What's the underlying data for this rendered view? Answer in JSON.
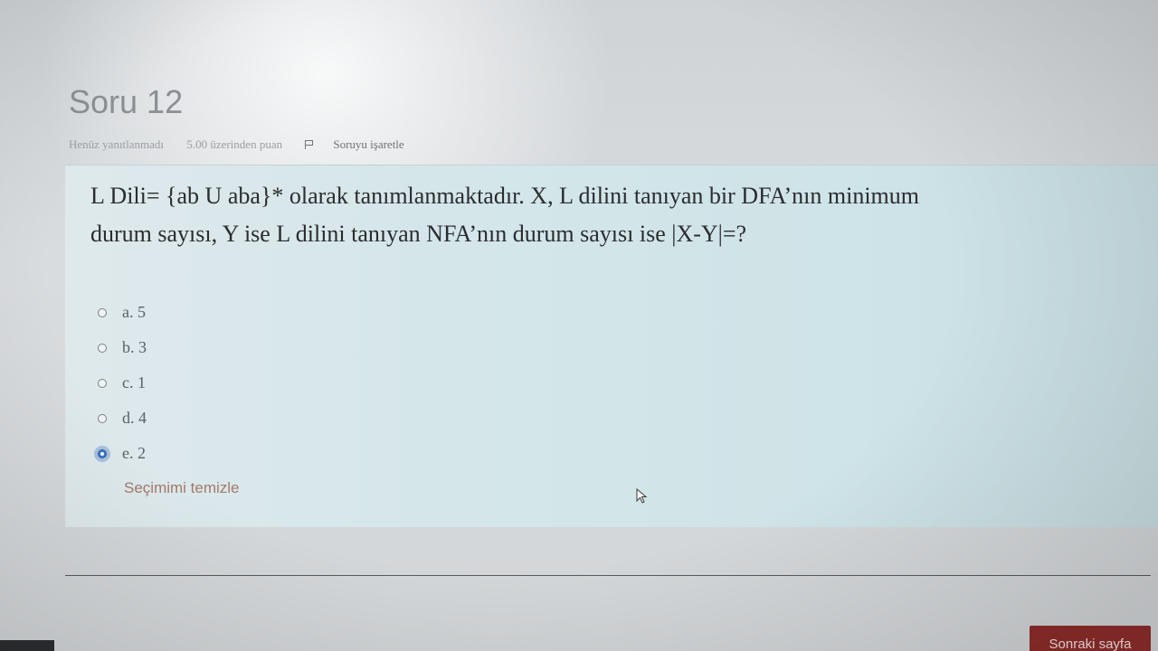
{
  "question": {
    "title": "Soru 12",
    "status": "Henüz yanıtlanmadı",
    "points": "5.00 üzerinden puan",
    "flag_label": "Soruyu işaretle",
    "text_line1": "L Dili= {ab U aba}* olarak tanımlanmaktadır. X, L dilini tanıyan bir DFA’nın minimum",
    "text_line2": "durum sayısı, Y ise L dilini tanıyan NFA’nın durum sayısı ise |X-Y|=?"
  },
  "answers": [
    {
      "label": "a. 5",
      "selected": false
    },
    {
      "label": "b. 3",
      "selected": false
    },
    {
      "label": "c. 1",
      "selected": false
    },
    {
      "label": "d. 4",
      "selected": false
    },
    {
      "label": "e. 2",
      "selected": true
    }
  ],
  "clear_label": "Seçimimi temizle",
  "next_button_label": "Sonraki sayfa",
  "colors": {
    "selected_radio": "#3f78c7",
    "next_button": "#8e2d2b",
    "question_bg": "#d4e6ea"
  }
}
